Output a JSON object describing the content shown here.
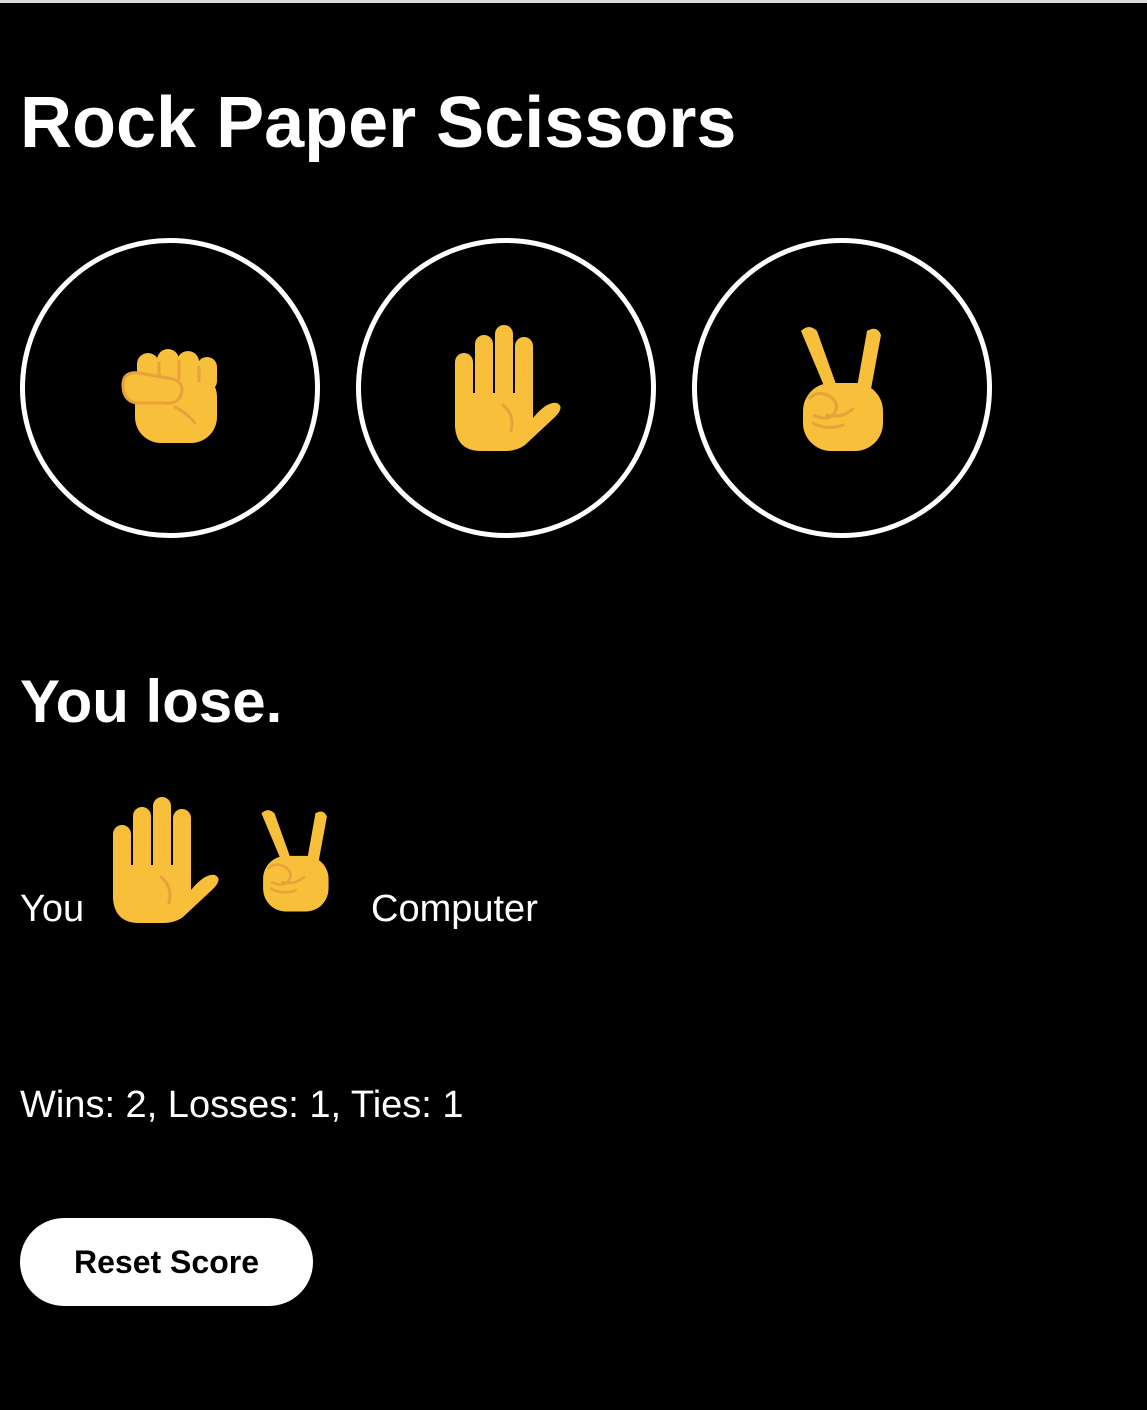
{
  "title": "Rock Paper Scissors",
  "moves": [
    {
      "name": "rock",
      "icon": "fist-emoji-icon"
    },
    {
      "name": "paper",
      "icon": "raised-hand-emoji-icon"
    },
    {
      "name": "scissors",
      "icon": "victory-hand-emoji-icon"
    }
  ],
  "result": "You lose.",
  "round": {
    "you_label": "You",
    "computer_label": "Computer",
    "player_move": "paper",
    "computer_move": "scissors"
  },
  "score_text": "Wins: 2, Losses: 1, Ties: 1",
  "reset_label": "Reset Score",
  "colors": {
    "background": "#000000",
    "text": "#ffffff",
    "emoji_fill": "#F8BF3B",
    "emoji_line": "#E8A23A",
    "button_bg": "#ffffff",
    "button_text": "#000000"
  }
}
